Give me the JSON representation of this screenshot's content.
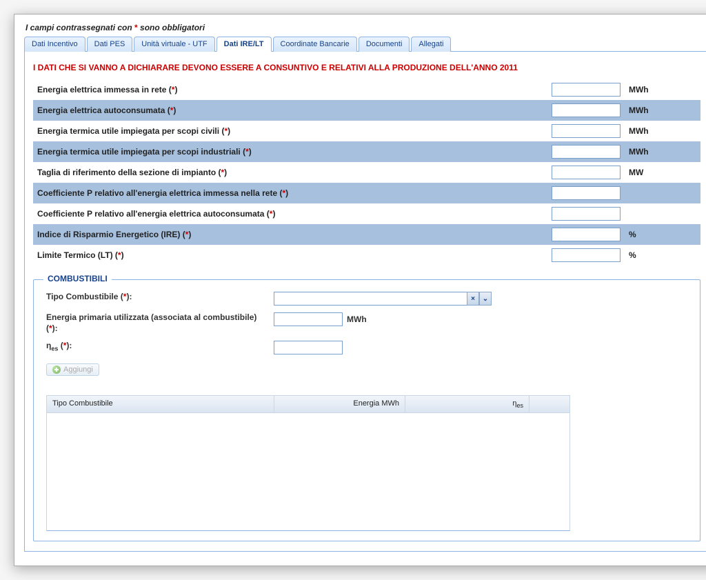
{
  "header_note_pre": "I campi contrassegnati con ",
  "header_note_ast": "*",
  "header_note_post": " sono obbligatori",
  "tabs": [
    {
      "label": "Dati Incentivo"
    },
    {
      "label": "Dati PES"
    },
    {
      "label": "Unità virtuale - UTF"
    },
    {
      "label": "Dati IRE/LT"
    },
    {
      "label": "Coordinate Bancarie"
    },
    {
      "label": "Documenti"
    },
    {
      "label": "Allegati"
    }
  ],
  "active_tab_index": 3,
  "warning": "I DATI CHE SI VANNO A DICHIARARE DEVONO ESSERE A CONSUNTIVO E RELATIVI ALLA PRODUZIONE DELL'ANNO 2011",
  "fields": [
    {
      "label": "Energia elettrica immessa in rete",
      "unit": "MWh",
      "alt": false
    },
    {
      "label": "Energia elettrica autoconsumata",
      "unit": "MWh",
      "alt": true
    },
    {
      "label": "Energia termica utile impiegata per scopi civili",
      "unit": "MWh",
      "alt": false
    },
    {
      "label": "Energia termica utile impiegata per scopi industriali",
      "unit": "MWh",
      "alt": true
    },
    {
      "label": "Taglia di riferimento della sezione di impianto",
      "unit": "MW",
      "alt": false
    },
    {
      "label": "Coefficiente P relativo all'energia elettrica immessa nella rete",
      "unit": "",
      "alt": true
    },
    {
      "label": "Coefficiente P relativo all'energia elettrica autoconsumata",
      "unit": "",
      "alt": false
    },
    {
      "label": "Indice di Risparmio Energetico (IRE)",
      "unit": "%",
      "alt": true
    },
    {
      "label": "Limite Termico (LT)",
      "unit": "%",
      "alt": false
    }
  ],
  "required_marker_open": "(",
  "required_marker_ast": "*",
  "required_marker_close": ")",
  "fieldset_legend": "COMBUSTIBILI",
  "fuel_form": {
    "tipo_label": "Tipo Combustibile",
    "energia_label": "Energia primaria utilizzata (associata al combustibile)",
    "energia_unit": "MWh",
    "eta_label_pre": "η",
    "eta_label_sub": "es",
    "add_button": "Aggiungi"
  },
  "grid": {
    "col1": "Tipo Combustibile",
    "col2": "Energia MWh",
    "col3_pre": "η",
    "col3_sub": "es"
  },
  "combo_clear_glyph": "×",
  "combo_drop_glyph": "⌄"
}
